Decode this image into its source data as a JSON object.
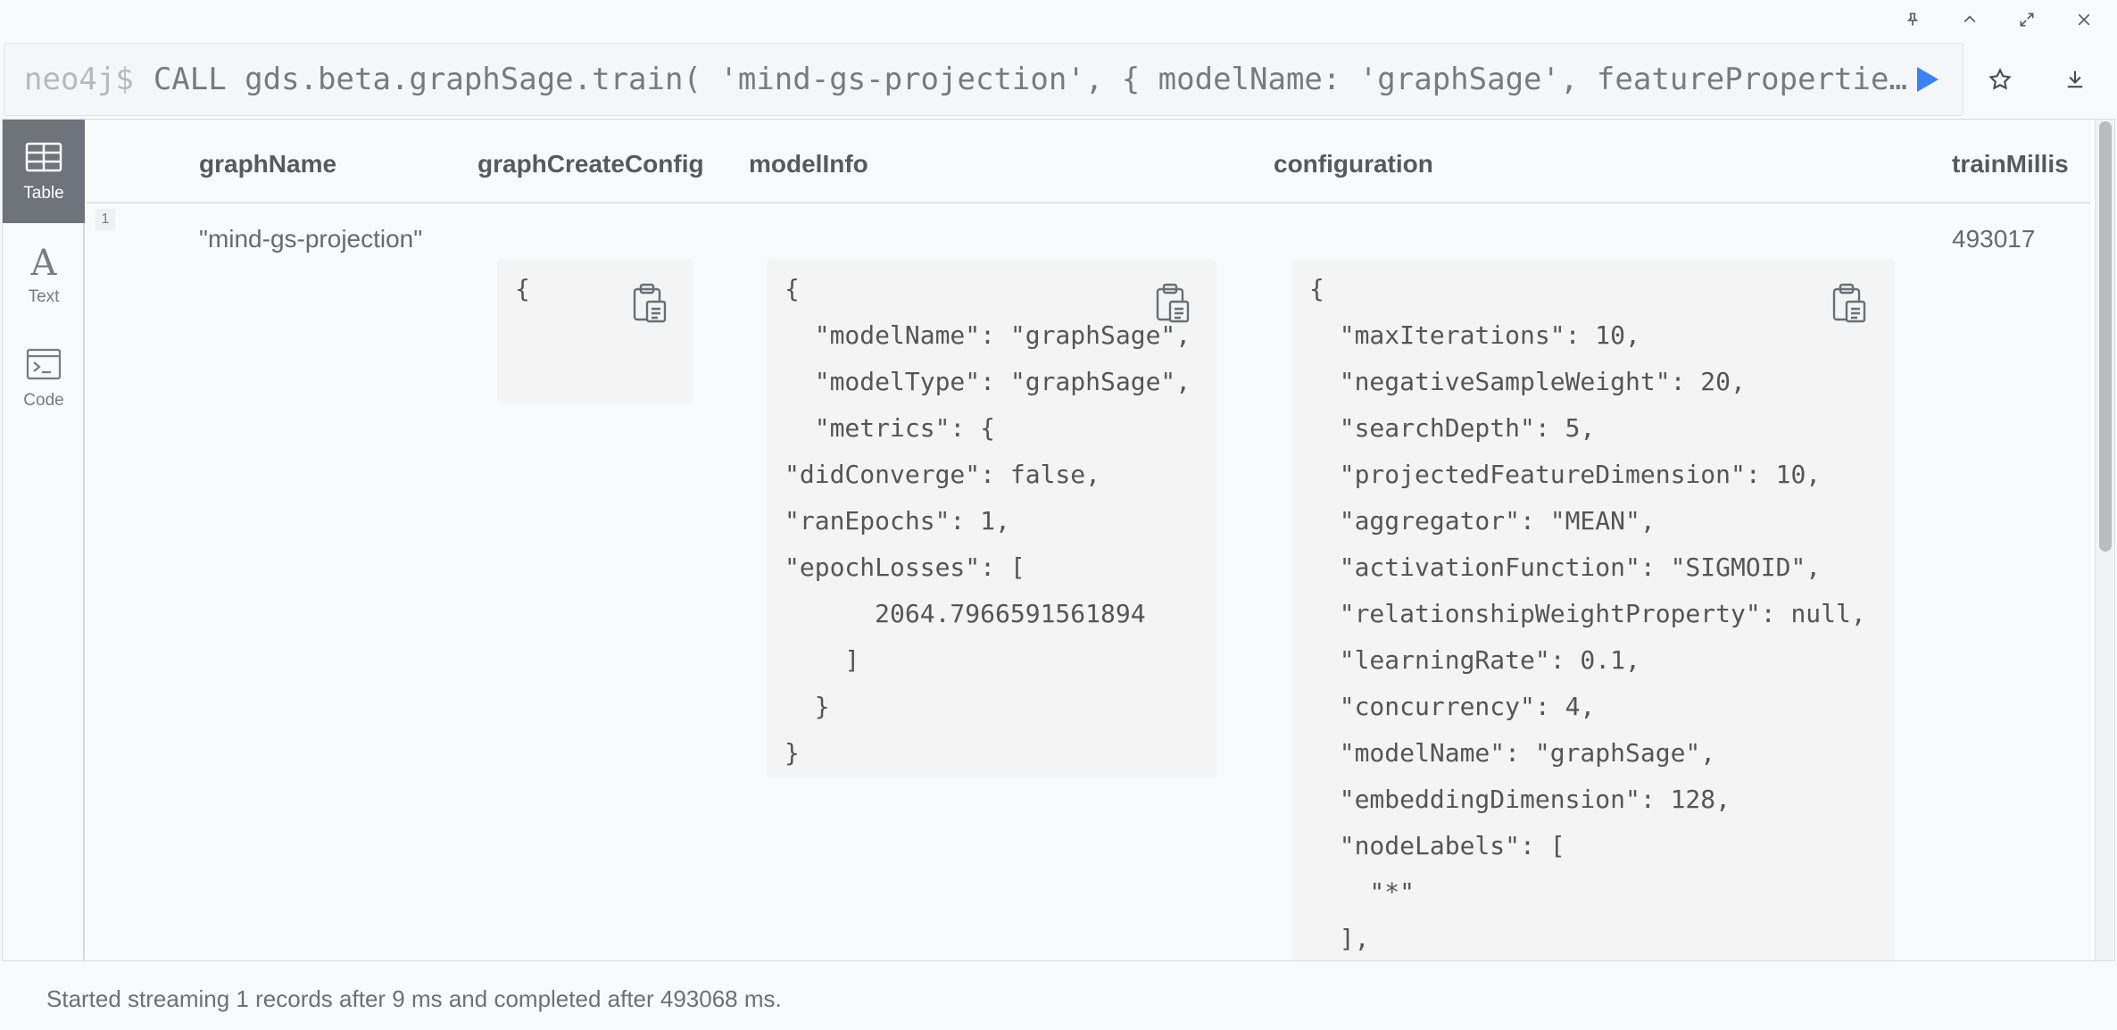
{
  "window_controls": {
    "pin": "pin-icon",
    "collapse": "chevron-up-icon",
    "expand": "expand-icon",
    "close": "close-icon"
  },
  "editor": {
    "prompt": "neo4j$",
    "query": "CALL gds.beta.graphSage.train( 'mind-gs-projection', { modelName: 'graphSage', featurePropertie…"
  },
  "toolbar": {
    "run": "play-icon",
    "favorite": "star-icon",
    "download": "download-icon"
  },
  "views": [
    {
      "label": "Table",
      "icon": "table-icon",
      "active": true
    },
    {
      "label": "Text",
      "icon": "text-icon",
      "active": false
    },
    {
      "label": "Code",
      "icon": "code-icon",
      "active": false
    }
  ],
  "table": {
    "columns": [
      "graphName",
      "graphCreateConfig",
      "modelInfo",
      "configuration",
      "trainMillis"
    ],
    "rows": [
      {
        "index": "1",
        "graphName": "\"mind-gs-projection\"",
        "graphCreateConfig": "{\n\n\n}",
        "modelInfo": "{\n  \"modelName\": \"graphSage\",\n  \"modelType\": \"graphSage\",\n  \"metrics\": {\n\"didConverge\": false,\n\"ranEpochs\": 1,\n\"epochLosses\": [\n      2064.7966591561894\n    ]\n  }\n}",
        "configuration": "{\n  \"maxIterations\": 10,\n  \"negativeSampleWeight\": 20,\n  \"searchDepth\": 5,\n  \"projectedFeatureDimension\": 10,\n  \"aggregator\": \"MEAN\",\n  \"activationFunction\": \"SIGMOID\",\n  \"relationshipWeightProperty\": null,\n  \"learningRate\": 0.1,\n  \"concurrency\": 4,\n  \"modelName\": \"graphSage\",\n  \"embeddingDimension\": 128,\n  \"nodeLabels\": [\n    \"*\"\n  ],",
        "trainMillis": "493017"
      }
    ]
  },
  "status": "Started streaming 1 records after 9 ms and completed after 493068 ms.",
  "colors": {
    "accent": "#3b82f6",
    "active_nav": "#6f737a"
  }
}
